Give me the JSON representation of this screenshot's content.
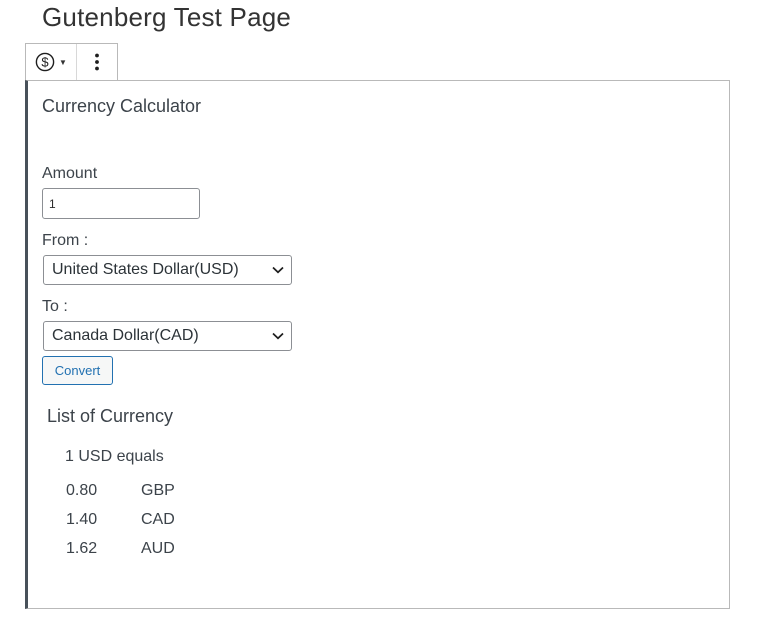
{
  "page": {
    "title": "Gutenberg Test Page"
  },
  "toolbar": {
    "block_type_icon": "currency-dollar-icon",
    "more_icon": "vertical-ellipsis-icon"
  },
  "calculator": {
    "title": "Currency Calculator",
    "amount_label": "Amount",
    "amount_value": "1",
    "from_label": "From :",
    "from_selected": "United States Dollar(USD)",
    "to_label": "To :",
    "to_selected": "Canada Dollar(CAD)",
    "convert_label": "Convert"
  },
  "currency_list": {
    "title": "List of Currency",
    "equals_text": "1 USD equals",
    "rates": [
      {
        "value": "0.80",
        "code": "GBP"
      },
      {
        "value": "1.40",
        "code": "CAD"
      },
      {
        "value": "1.62",
        "code": "AUD"
      }
    ]
  },
  "colors": {
    "accent": "#2271b1",
    "block_border": "#48515a"
  }
}
